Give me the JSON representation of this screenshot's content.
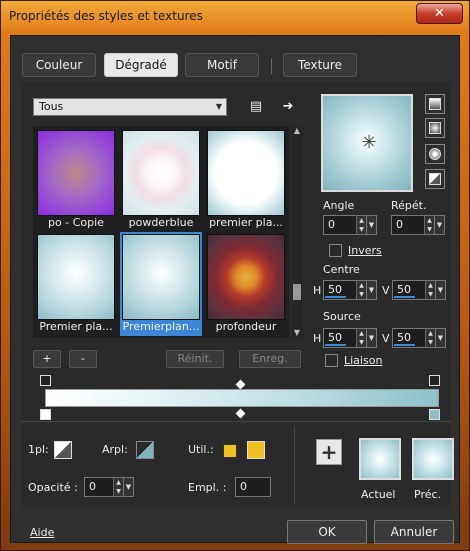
{
  "window": {
    "title": "Propriétés des styles et textures",
    "close_label": "✕"
  },
  "tabs": [
    {
      "label": "Couleur",
      "active": false
    },
    {
      "label": "Dégradé",
      "active": true
    },
    {
      "label": "Motif",
      "active": false
    },
    {
      "label": "Texture",
      "active": false
    }
  ],
  "library": {
    "category": "Tous",
    "items": [
      {
        "label": "po - Copie",
        "selected": false
      },
      {
        "label": "powderblue",
        "selected": false
      },
      {
        "label": "premier pla...",
        "selected": false
      },
      {
        "label": "Premier pla...",
        "selected": false
      },
      {
        "label": "Premierplan...",
        "selected": true
      },
      {
        "label": "profondeur",
        "selected": false
      }
    ]
  },
  "buttons": {
    "add": "+",
    "remove": "-",
    "reset": "Réinit.",
    "save": "Enreg."
  },
  "params": {
    "angle_label": "Angle",
    "angle_value": "0",
    "repeat_label": "Répét.",
    "repeat_value": "0",
    "invert_label": "Invers",
    "center_label": "Centre",
    "center_h_label": "H",
    "center_h": "50",
    "center_v_label": "V",
    "center_v": "50",
    "source_label": "Source",
    "source_h_label": "H",
    "source_h": "50",
    "source_v_label": "V",
    "source_v": "50",
    "link_label": "Liaison"
  },
  "bottom": {
    "first_label": "1pl:",
    "bg_label": "Arpl:",
    "util_label": "Util.:",
    "opacity_label": "Opacité :",
    "opacity_value": "0",
    "empl_label": "Empl. :",
    "empl_value": "0",
    "current_label": "Actuel",
    "previous_label": "Préc.",
    "accent_swatch": "#f0c020"
  },
  "footer": {
    "help": "Aide",
    "ok": "OK",
    "cancel": "Annuler"
  }
}
